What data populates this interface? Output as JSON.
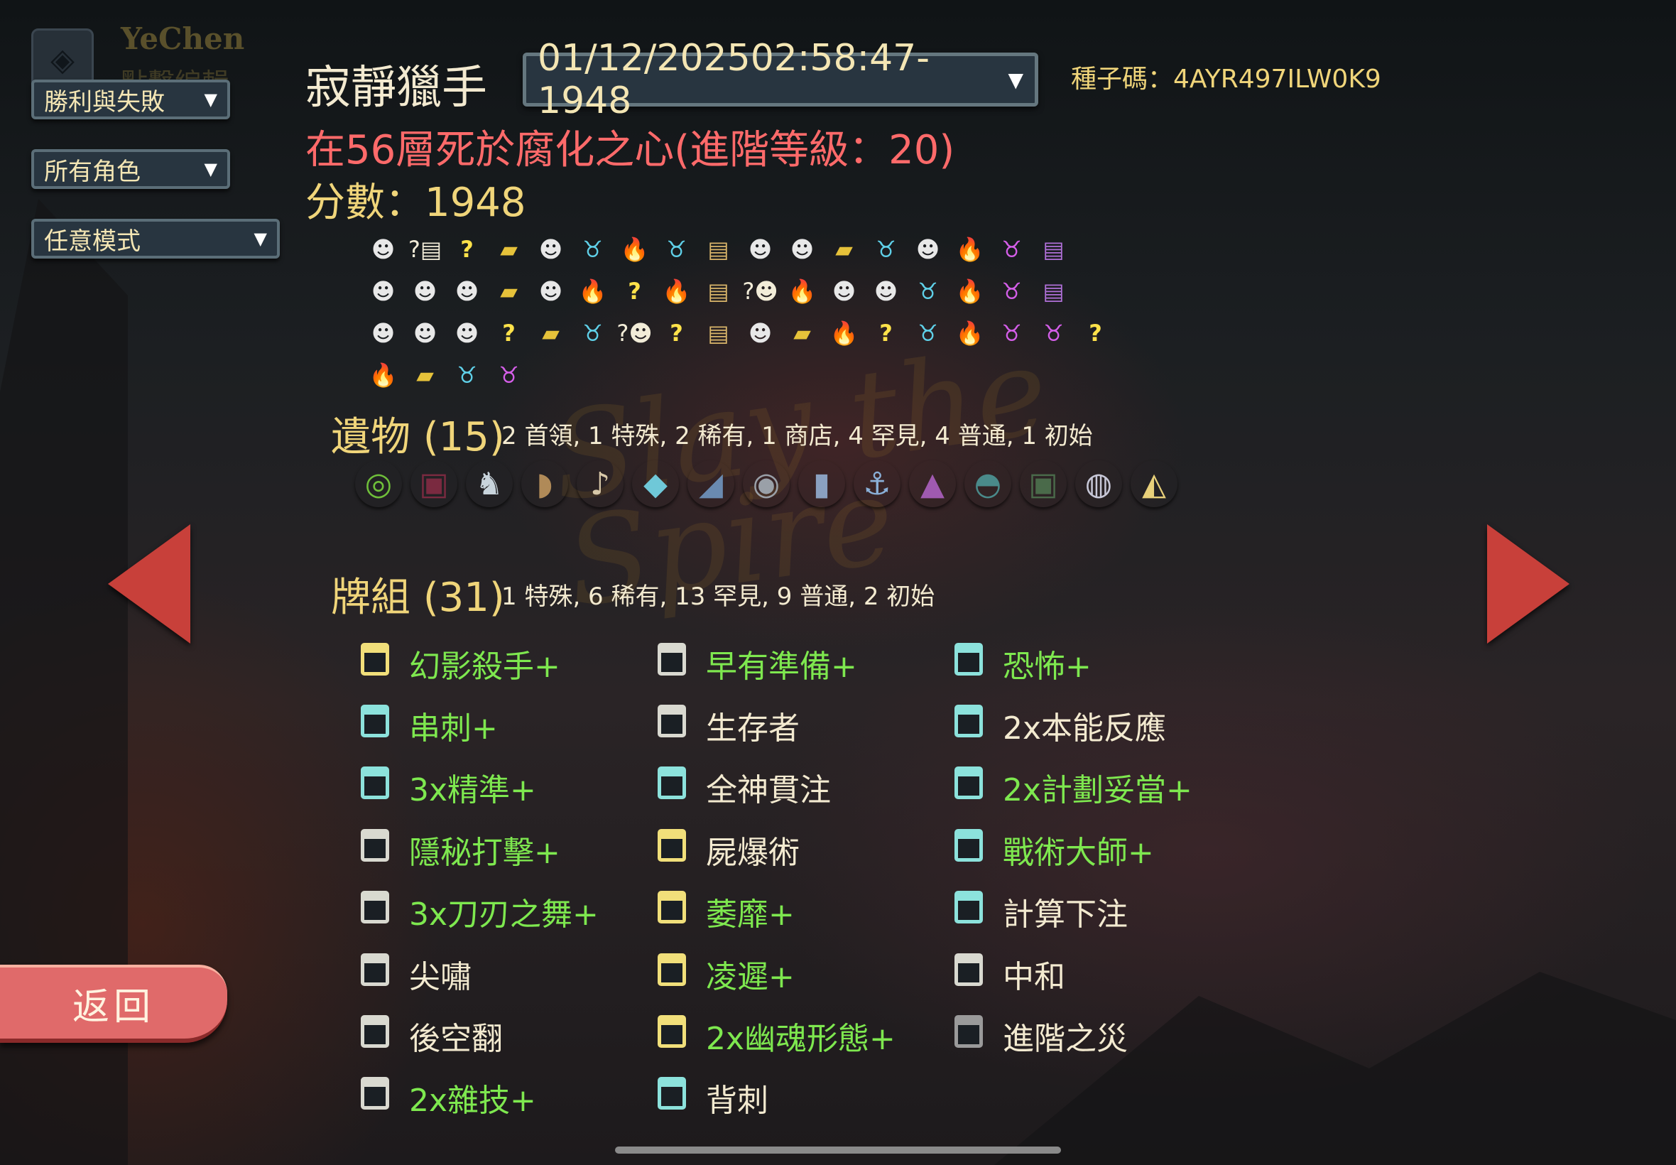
{
  "profile": {
    "name": "YeChen",
    "subtitle": "點擊編輯"
  },
  "filters": [
    {
      "label": "勝利與失敗"
    },
    {
      "label": "所有角色"
    },
    {
      "label": "任意模式"
    }
  ],
  "run": {
    "character_title": "寂靜獵手",
    "selected_run": "01/12/202502:58:47-1948",
    "seed_text": "種子碼：4AYR497ILW0K9",
    "death_text": "在56層死於腐化之心(進階等級：20)",
    "score_text": "分數：1948"
  },
  "path": {
    "icons": {
      "monster": "☻",
      "elite": "♉",
      "rest": "🔥",
      "shop": "▰",
      "unknown": "?",
      "treasure": "▤",
      "boss": "♉",
      "chest": "▤",
      "unknown-chest": "?▤",
      "unknown-monster": "?☻"
    },
    "rows": [
      [
        "monster",
        "unknown-chest",
        "unknown",
        "shop",
        "monster",
        "elite",
        "rest",
        "elite",
        "treasure",
        "monster",
        "monster",
        "shop",
        "elite",
        "monster",
        "rest",
        "boss",
        "chest"
      ],
      [
        "monster",
        "monster",
        "monster",
        "shop",
        "monster",
        "rest",
        "unknown",
        "rest",
        "treasure",
        "unknown-monster",
        "rest",
        "monster",
        "monster",
        "elite",
        "rest",
        "boss",
        "chest"
      ],
      [
        "monster",
        "monster",
        "monster",
        "unknown",
        "shop",
        "elite",
        "unknown-monster",
        "unknown",
        "treasure",
        "monster",
        "shop",
        "rest",
        "unknown",
        "elite",
        "rest",
        "boss",
        "boss",
        "unknown"
      ],
      [
        "rest",
        "shop",
        "elite",
        "boss"
      ]
    ]
  },
  "relics": {
    "title": "遺物",
    "count": "(15)",
    "summary": "2 首領, 1 特殊, 2 稀有, 1 商店, 4 罕見, 4 普通, 1 初始",
    "items": [
      {
        "icon": "ring-icon",
        "glyph": "◎",
        "color": "#6fbf3a"
      },
      {
        "icon": "box-icon",
        "glyph": "▣",
        "color": "#7a2a40"
      },
      {
        "icon": "elephant-icon",
        "glyph": "♞",
        "color": "#c8d4dc"
      },
      {
        "icon": "bag-icon",
        "glyph": "◗",
        "color": "#b08a58"
      },
      {
        "icon": "pipe-icon",
        "glyph": "♪",
        "color": "#d8c8a8"
      },
      {
        "icon": "crystal-icon",
        "glyph": "◆",
        "color": "#6fc8d8"
      },
      {
        "icon": "shark-icon",
        "glyph": "◢",
        "color": "#6a8ab0"
      },
      {
        "icon": "orb-icon",
        "glyph": "◉",
        "color": "#9aa0a8"
      },
      {
        "icon": "jar-icon",
        "glyph": "▮",
        "color": "#8aa0c0"
      },
      {
        "icon": "anchor-icon",
        "glyph": "⚓",
        "color": "#8ab0d8"
      },
      {
        "icon": "tent-icon",
        "glyph": "▲",
        "color": "#a05ab0"
      },
      {
        "icon": "chest-icon",
        "glyph": "◓",
        "color": "#4a8a8a"
      },
      {
        "icon": "lantern-icon",
        "glyph": "▣",
        "color": "#4a6a4a"
      },
      {
        "icon": "compass-icon",
        "glyph": "◍",
        "color": "#c8c8d8"
      },
      {
        "icon": "crane-icon",
        "glyph": "◭",
        "color": "#e8d07a"
      }
    ]
  },
  "deck": {
    "title": "牌組",
    "count": "(31)",
    "summary": "1 特殊, 6 稀有, 13 罕見, 9 普通, 2 初始",
    "cards": [
      {
        "name": "幻影殺手+",
        "upgraded": true,
        "rarity": "rare"
      },
      {
        "name": "早有準備+",
        "upgraded": true,
        "rarity": "common"
      },
      {
        "name": "恐怖+",
        "upgraded": true,
        "rarity": "uncommon"
      },
      {
        "name": "串刺+",
        "upgraded": true,
        "rarity": "uncommon"
      },
      {
        "name": "生存者",
        "upgraded": false,
        "rarity": "basic"
      },
      {
        "name": "2x本能反應",
        "upgraded": false,
        "rarity": "uncommon"
      },
      {
        "name": "3x精準+",
        "upgraded": true,
        "rarity": "uncommon"
      },
      {
        "name": "全神貫注",
        "upgraded": false,
        "rarity": "uncommon"
      },
      {
        "name": "2x計劃妥當+",
        "upgraded": true,
        "rarity": "uncommon"
      },
      {
        "name": "隱秘打擊+",
        "upgraded": true,
        "rarity": "common"
      },
      {
        "name": "屍爆術",
        "upgraded": false,
        "rarity": "rare"
      },
      {
        "name": "戰術大師+",
        "upgraded": true,
        "rarity": "uncommon"
      },
      {
        "name": "3x刀刃之舞+",
        "upgraded": true,
        "rarity": "common"
      },
      {
        "name": "萎靡+",
        "upgraded": true,
        "rarity": "rare"
      },
      {
        "name": "計算下注",
        "upgraded": false,
        "rarity": "uncommon"
      },
      {
        "name": "尖嘯",
        "upgraded": false,
        "rarity": "common"
      },
      {
        "name": "凌遲+",
        "upgraded": true,
        "rarity": "rare"
      },
      {
        "name": "中和",
        "upgraded": false,
        "rarity": "basic"
      },
      {
        "name": "後空翻",
        "upgraded": false,
        "rarity": "common"
      },
      {
        "name": "2x幽魂形態+",
        "upgraded": true,
        "rarity": "rare"
      },
      {
        "name": "進階之災",
        "upgraded": false,
        "rarity": "curse"
      },
      {
        "name": "2x雜技+",
        "upgraded": true,
        "rarity": "common"
      },
      {
        "name": "背刺",
        "upgraded": false,
        "rarity": "uncommon"
      }
    ]
  },
  "back_label": "返回",
  "watermark": "Slay the Spire"
}
